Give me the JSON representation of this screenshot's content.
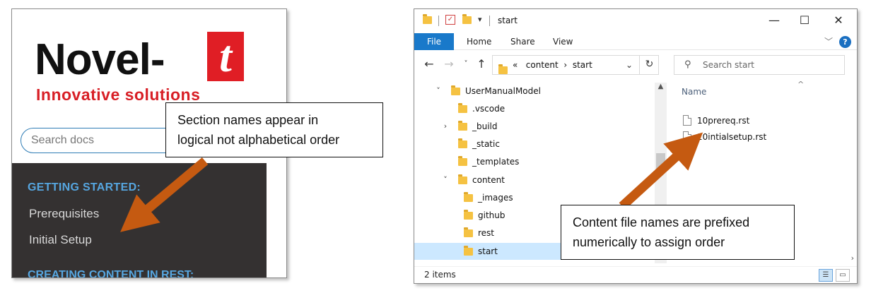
{
  "docs_panel": {
    "logo_word": "Novel-",
    "logo_letter": "t",
    "logo_tagline": "Innovative solutions",
    "search_placeholder": "Search docs",
    "nav": {
      "caption_1": "GETTING STARTED:",
      "items": [
        "Prerequisites",
        "Initial Setup"
      ],
      "caption_2": "CREATING CONTENT IN REST:"
    }
  },
  "explorer": {
    "title": "start",
    "ribbon_tabs": [
      "File",
      "Home",
      "Share",
      "View"
    ],
    "help_label": "?",
    "address": {
      "breadcrumb_root": "«",
      "crumbs": [
        "content",
        "start"
      ],
      "separator": "›"
    },
    "search_placeholder": "Search start",
    "tree": [
      {
        "label": "UserManualModel",
        "expanded": true
      },
      {
        "label": ".vscode"
      },
      {
        "label": "_build",
        "collapsed": true
      },
      {
        "label": "_static"
      },
      {
        "label": "_templates"
      },
      {
        "label": "content",
        "expanded": true
      },
      {
        "label": "_images"
      },
      {
        "label": "github"
      },
      {
        "label": "rest"
      },
      {
        "label": "start",
        "selected": true
      }
    ],
    "column_header": "Name",
    "files": [
      "10prereq.rst",
      "20intialsetup.rst"
    ],
    "status": "2 items"
  },
  "callouts": {
    "left": [
      "Section names appear in",
      "logical not alphabetical order"
    ],
    "right": [
      "Content file names are prefixed",
      "numerically to assign order"
    ]
  },
  "colors": {
    "arrow": "#c55a11",
    "nav_bg": "#343131",
    "nav_caption": "#56a6e0",
    "logo_red": "#e01e25",
    "ribbon_file": "#1979ca",
    "selection": "#cce8ff"
  },
  "icons": [
    "folder-icon",
    "file-icon",
    "back-arrow-icon",
    "forward-arrow-icon",
    "up-arrow-icon",
    "refresh-icon",
    "search-icon",
    "minimize-icon",
    "maximize-icon",
    "close-icon",
    "help-icon"
  ]
}
